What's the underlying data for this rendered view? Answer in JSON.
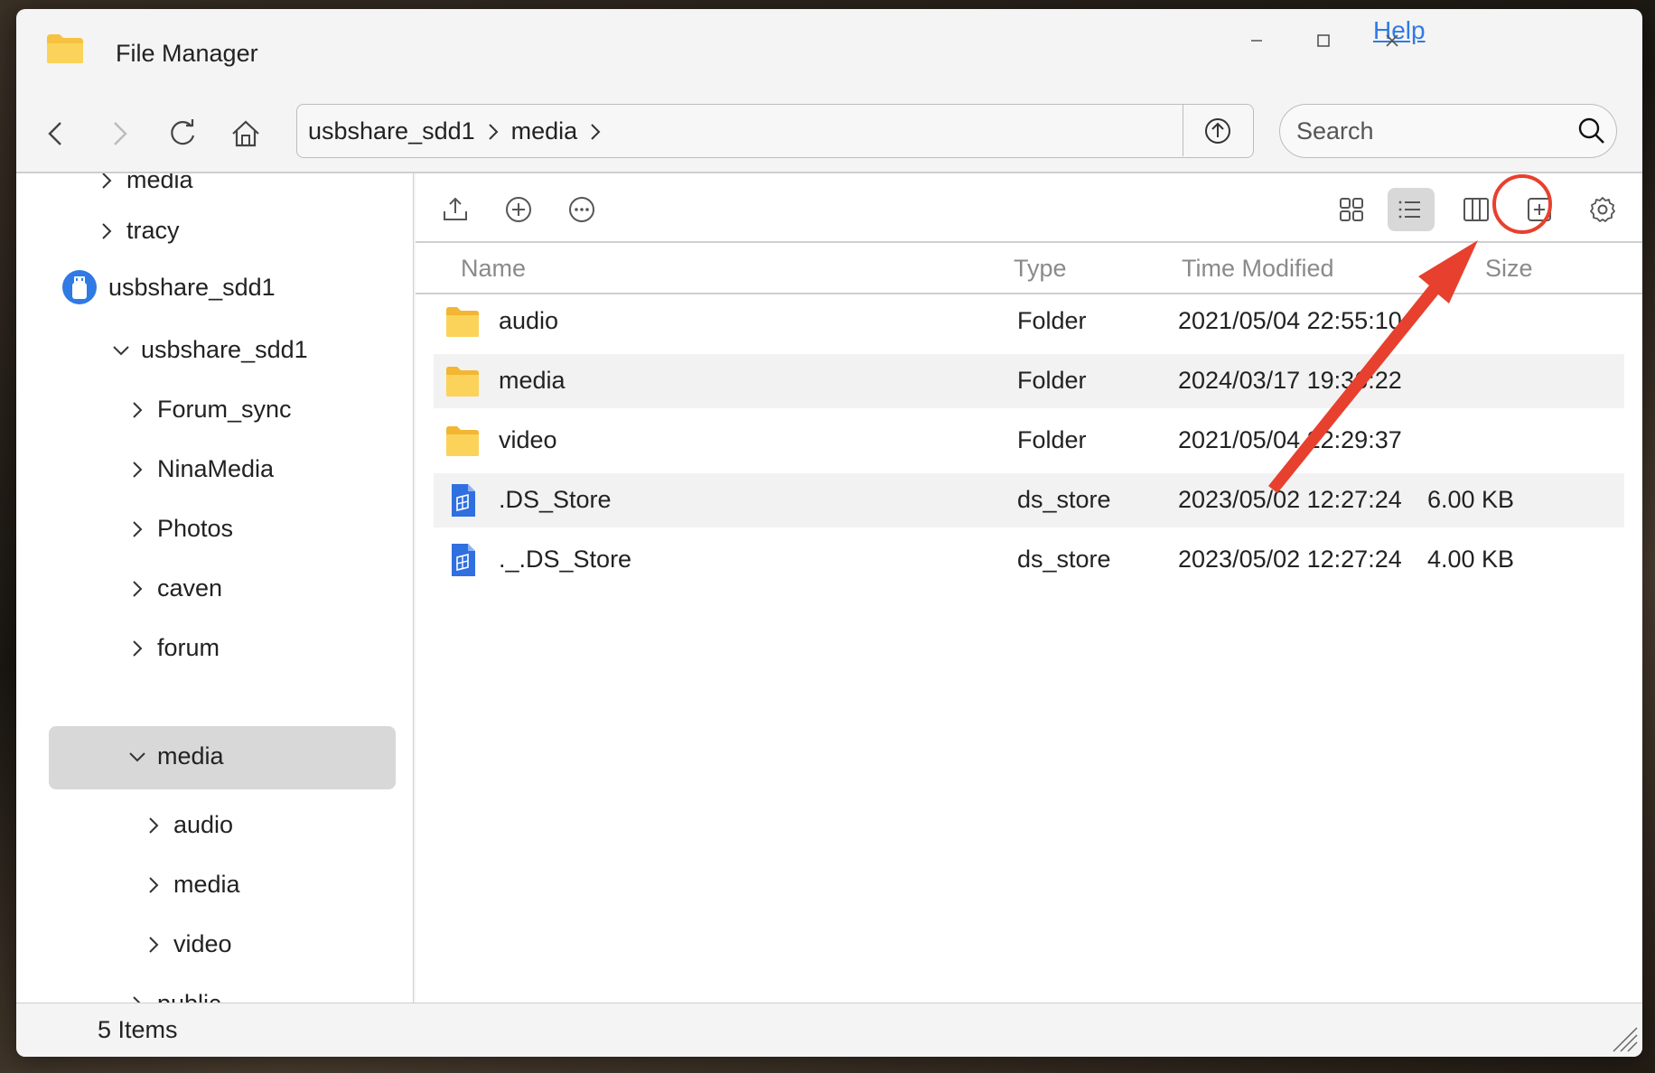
{
  "window": {
    "title": "File Manager",
    "help_label": "Help"
  },
  "nav": {
    "path": [
      "usbshare_sdd1",
      "media"
    ],
    "search_placeholder": "Search"
  },
  "sidebar": {
    "items": [
      {
        "label": "media",
        "expanded": false
      },
      {
        "label": "tracy",
        "expanded": false
      },
      {
        "label": "usbshare_sdd1",
        "device": true
      },
      {
        "label": "usbshare_sdd1",
        "expanded": true
      },
      {
        "label": "Forum_sync",
        "expanded": false
      },
      {
        "label": "NinaMedia",
        "expanded": false
      },
      {
        "label": "Photos",
        "expanded": false
      },
      {
        "label": "caven",
        "expanded": false
      },
      {
        "label": "forum",
        "expanded": false
      },
      {
        "label": "media",
        "expanded": true,
        "selected": true
      },
      {
        "label": "audio",
        "expanded": false
      },
      {
        "label": "media",
        "expanded": false
      },
      {
        "label": "video",
        "expanded": false
      },
      {
        "label": "public",
        "expanded": false
      }
    ]
  },
  "table": {
    "columns": [
      "Name",
      "Type",
      "Time Modified",
      "Size"
    ],
    "rows": [
      {
        "name": "audio",
        "type": "Folder",
        "modified": "2021/05/04 22:55:10",
        "size": "",
        "icon": "folder-icon"
      },
      {
        "name": "media",
        "type": "Folder",
        "modified": "2024/03/17 19:36:22",
        "size": "",
        "icon": "folder-icon"
      },
      {
        "name": "video",
        "type": "Folder",
        "modified": "2021/05/04 22:29:37",
        "size": "",
        "icon": "folder-icon"
      },
      {
        "name": ".DS_Store",
        "type": "ds_store",
        "modified": "2023/05/02 12:27:24",
        "size": "6.00 KB",
        "icon": "file-icon"
      },
      {
        "name": "._.DS_Store",
        "type": "ds_store",
        "modified": "2023/05/02 12:27:24",
        "size": "4.00 KB",
        "icon": "file-icon"
      }
    ]
  },
  "toolbar": {
    "left_icons": [
      "upload-icon",
      "add-circle-icon",
      "more-icon"
    ],
    "right_icons": [
      "grid-view-icon",
      "list-view-icon",
      "column-view-icon",
      "add-square-icon",
      "settings-icon"
    ],
    "active_view": "list-view-icon"
  },
  "status": {
    "items_label": "5 Items"
  },
  "colors": {
    "accent": "#2f7ae5",
    "folder": "#f7c242",
    "annotation_red": "#e8402e",
    "selected_bg": "#d8d8d8"
  }
}
